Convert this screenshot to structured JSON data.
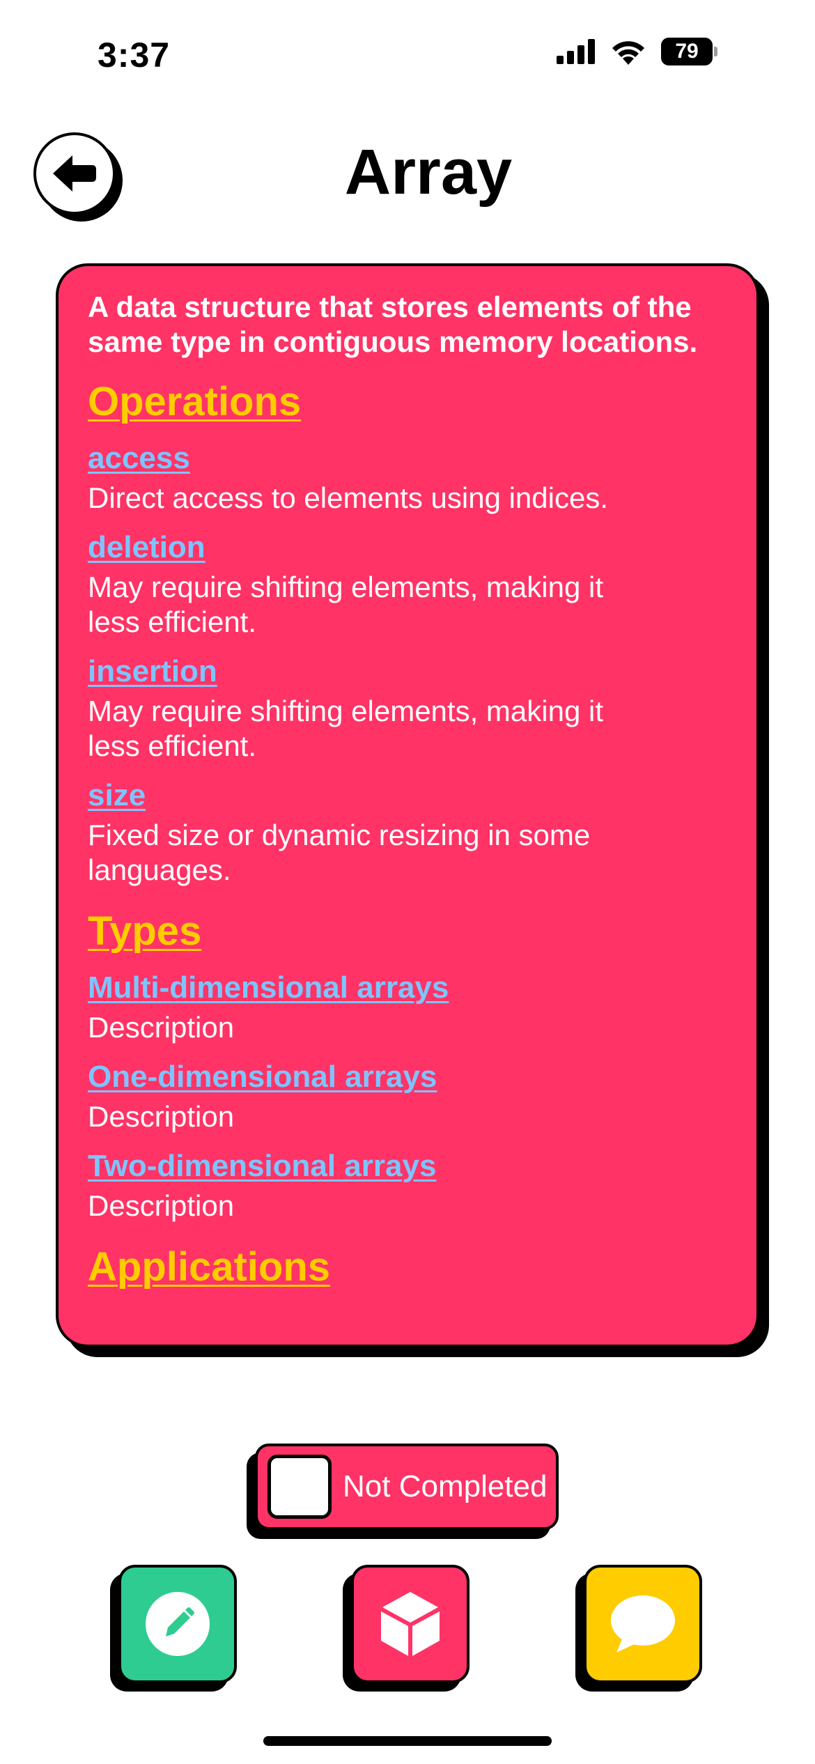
{
  "status_bar": {
    "time": "3:37",
    "battery": "79"
  },
  "header": {
    "title": "Array"
  },
  "card": {
    "description": "A data structure that stores elements of the same type in contiguous memory locations.",
    "sections": {
      "operations": {
        "title": "Operations",
        "items": [
          {
            "name": "access",
            "text": "Direct access to elements using indices."
          },
          {
            "name": "deletion",
            "text": "May require shifting elements, making it less efficient."
          },
          {
            "name": "insertion",
            "text": "May require shifting elements, making it less efficient."
          },
          {
            "name": "size",
            "text": "Fixed size or dynamic resizing in some languages."
          }
        ]
      },
      "types": {
        "title": "Types",
        "items": [
          {
            "name": "Multi-dimensional arrays",
            "text": "Description"
          },
          {
            "name": "One-dimensional arrays",
            "text": "Description"
          },
          {
            "name": "Two-dimensional arrays",
            "text": "Description"
          }
        ]
      },
      "applications": {
        "title": "Applications"
      }
    }
  },
  "completion": {
    "label": "Not Completed",
    "checked": false
  },
  "bottom_bar": {
    "buttons": [
      {
        "icon": "pencil-icon",
        "color": "#2ecc91"
      },
      {
        "icon": "cube-icon",
        "color": "#ff3366"
      },
      {
        "icon": "chat-bubble-icon",
        "color": "#ffcc00"
      }
    ]
  },
  "colors": {
    "card": "#ff3366",
    "heading": "#ffcc00",
    "link": "#7ec4ff"
  }
}
